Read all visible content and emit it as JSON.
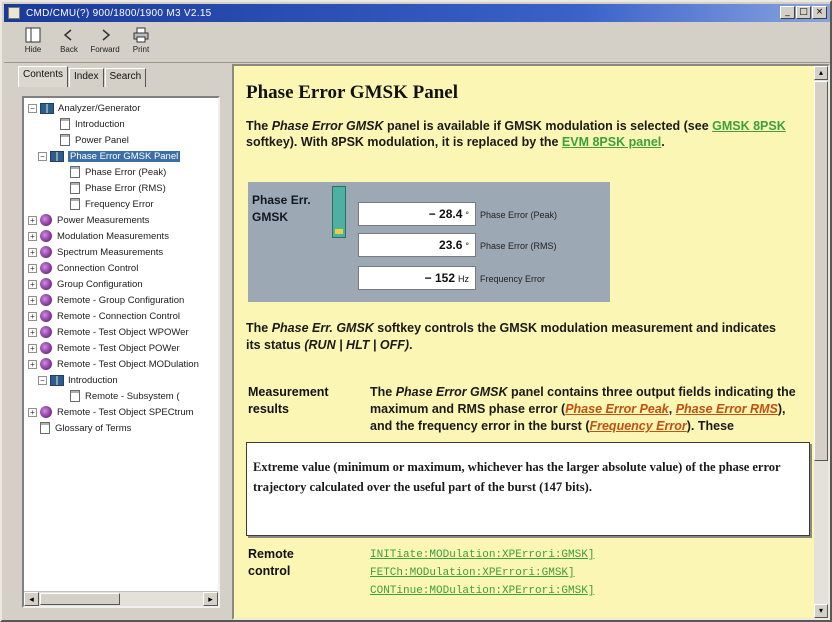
{
  "window": {
    "title": "CMD/CMU(?) 900/1800/1900 M3 V2.15",
    "buttons": {
      "minimize": "_",
      "maximize": "□",
      "close": "×"
    }
  },
  "toolbar": {
    "hide": "Hide",
    "back": "Back",
    "forward": "Forward",
    "print": "Print"
  },
  "tabs": {
    "contents": "Contents",
    "index": "Index",
    "search": "Search"
  },
  "tree": [
    {
      "label": "Analyzer/Generator",
      "expander": "−",
      "icon": "book",
      "indent": 0
    },
    {
      "label": "Introduction",
      "expander": "",
      "icon": "page",
      "indent": 2
    },
    {
      "label": "Power Panel",
      "expander": "",
      "icon": "page",
      "indent": 2
    },
    {
      "label": "Phase Error GMSK Panel",
      "expander": "−",
      "icon": "book",
      "indent": 1,
      "selected": true
    },
    {
      "label": "Phase Error (Peak)",
      "expander": "",
      "icon": "page",
      "indent": 3
    },
    {
      "label": "Phase Error (RMS)",
      "expander": "",
      "icon": "page",
      "indent": 3
    },
    {
      "label": "Frequency Error",
      "expander": "",
      "icon": "page",
      "indent": 3
    },
    {
      "label": "Power Measurements",
      "expander": "+",
      "icon": "purple",
      "indent": 0
    },
    {
      "label": "Modulation Measurements",
      "expander": "+",
      "icon": "purple",
      "indent": 0
    },
    {
      "label": "Spectrum Measurements",
      "expander": "+",
      "icon": "purple",
      "indent": 0
    },
    {
      "label": "Connection Control",
      "expander": "+",
      "icon": "purple",
      "indent": 0
    },
    {
      "label": "Group Configuration",
      "expander": "+",
      "icon": "purple",
      "indent": 0
    },
    {
      "label": "Remote - Group Configuration",
      "expander": "+",
      "icon": "purple",
      "indent": 0
    },
    {
      "label": "Remote - Connection Control",
      "expander": "+",
      "icon": "purple",
      "indent": 0
    },
    {
      "label": "Remote - Test Object WPOWer",
      "expander": "+",
      "icon": "purple",
      "indent": 0
    },
    {
      "label": "Remote - Test Object POWer",
      "expander": "+",
      "icon": "purple",
      "indent": 0
    },
    {
      "label": "Remote - Test Object MODulation",
      "expander": "+",
      "icon": "purple",
      "indent": 0
    },
    {
      "label": "Introduction",
      "expander": "−",
      "icon": "book",
      "indent": 1
    },
    {
      "label": "Remote - Subsystem (",
      "expander": "",
      "icon": "page",
      "indent": 3
    },
    {
      "label": "Remote - Test Object SPECtrum",
      "expander": "+",
      "icon": "purple",
      "indent": 0
    },
    {
      "label": "Glossary of Terms",
      "expander": "",
      "icon": "page",
      "indent": 0
    }
  ],
  "content": {
    "heading": "Phase Error GMSK Panel",
    "p1": {
      "a": "The ",
      "b": "Phase Error GMSK",
      "c": " panel is available if GMSK modulation is selected (see ",
      "link1": "GMSK 8PSK",
      "d": " softkey). With 8PSK modulation, it is replaced by the ",
      "link2": "EVM 8PSK panel",
      "e": "."
    },
    "panel": {
      "title_line1": "Phase Err.",
      "title_line2": "GMSK",
      "fields": [
        {
          "value": "− 28.4",
          "unit": "°",
          "label": "Phase Error (Peak)"
        },
        {
          "value": "23.6",
          "unit": "°",
          "label": "Phase Error (RMS)"
        },
        {
          "value": "− 152",
          "unit": "Hz",
          "label": "Frequency Error"
        }
      ]
    },
    "p2": {
      "a": "The ",
      "b": "Phase Err. GMSK",
      "c": " softkey controls the GMSK modulation measurement and indicates its status ",
      "d": "(RUN | HLT | OFF)",
      "e": "."
    },
    "measurement": {
      "label1": "Measurement",
      "label2": "results",
      "a": "The ",
      "b": "Phase Error GMSK",
      "c": " panel contains three output fields indicating the maximum and RMS phase error (",
      "link1": "Phase Error Peak",
      "d": ", ",
      "link2": "Phase Error RMS",
      "e": "), and the frequency error in the burst (",
      "link3": "Frequency Error",
      "f": "). These"
    },
    "tooltip": "Extreme value (minimum or maximum, whichever has the larger absolute value) of the phase error trajectory calculated over the useful part of the burst (147 bits).",
    "remote": {
      "label1": "Remote",
      "label2": "control",
      "commands": [
        "INITiate:MODulation:XPErrori:GMSK]",
        "FETCh:MODulation:XPErrori:GMSK]",
        "CONTinue:MODulation:XPErrori:GMSK]"
      ]
    }
  },
  "colors": {
    "content_bg": "#fbf6b3",
    "link_green": "#3d9f3d",
    "link_red": "#c25010",
    "panel_bg": "#9ca8b4"
  }
}
